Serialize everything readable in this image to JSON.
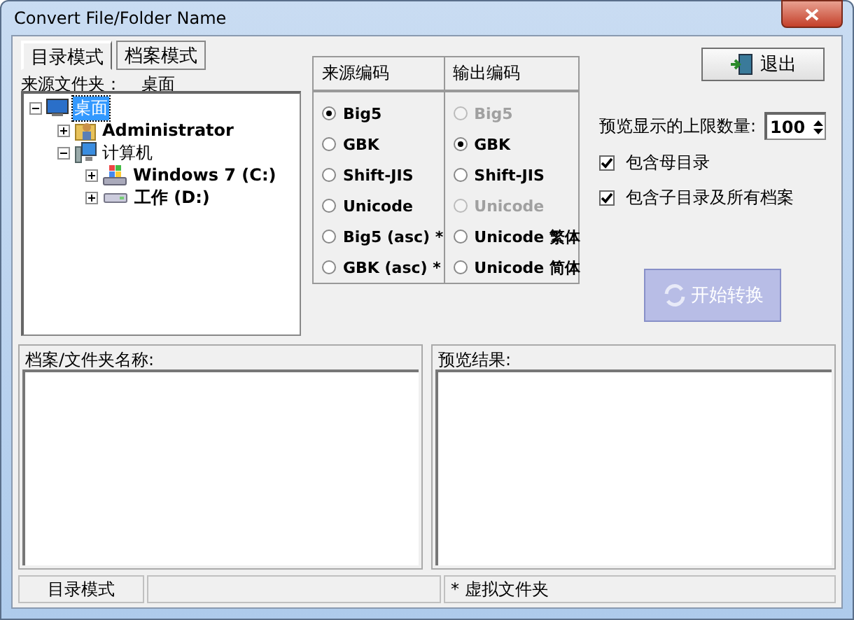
{
  "window": {
    "title": "Convert File/Folder Name"
  },
  "tabs": [
    {
      "label": "目录模式",
      "selected": true
    },
    {
      "label": "档案模式",
      "selected": false
    }
  ],
  "exit_button": {
    "label": "退出"
  },
  "source_folder": {
    "label": "来源文件夹：",
    "value": "桌面"
  },
  "tree": [
    {
      "label": "桌面",
      "kind": "desktop",
      "bold": false,
      "expanded": true,
      "selected": true,
      "children": [
        {
          "label": "Administrator",
          "kind": "user",
          "bold": true,
          "expanded": false,
          "selected": false
        },
        {
          "label": "计算机",
          "kind": "computer",
          "bold": false,
          "expanded": true,
          "selected": false,
          "children": [
            {
              "label": "Windows 7 (C:)",
              "kind": "system-drive",
              "bold": true,
              "expanded": false,
              "selected": false
            },
            {
              "label": "工作 (D:)",
              "kind": "drive",
              "bold": true,
              "expanded": false,
              "selected": false
            }
          ]
        }
      ]
    }
  ],
  "encoding": {
    "columns": [
      "来源编码",
      "输出编码"
    ],
    "source": [
      {
        "label": "Big5",
        "selected": true,
        "disabled": false
      },
      {
        "label": "GBK",
        "selected": false,
        "disabled": false
      },
      {
        "label": "Shift-JIS",
        "selected": false,
        "disabled": false
      },
      {
        "label": "Unicode",
        "selected": false,
        "disabled": false
      },
      {
        "label": "Big5 (asc) *",
        "selected": false,
        "disabled": false
      },
      {
        "label": "GBK (asc) *",
        "selected": false,
        "disabled": false
      }
    ],
    "output": [
      {
        "label": "Big5",
        "selected": false,
        "disabled": true
      },
      {
        "label": "GBK",
        "selected": true,
        "disabled": false
      },
      {
        "label": "Shift-JIS",
        "selected": false,
        "disabled": false
      },
      {
        "label": "Unicode",
        "selected": false,
        "disabled": true
      },
      {
        "label": "Unicode 繁体",
        "selected": false,
        "disabled": false
      },
      {
        "label": "Unicode 简体",
        "selected": false,
        "disabled": false
      }
    ]
  },
  "preview_limit": {
    "label": "预览显示的上限数量:",
    "value": "100"
  },
  "checkboxes": [
    {
      "label": "包含母目录",
      "checked": true
    },
    {
      "label": "包含子目录及所有档案",
      "checked": true
    }
  ],
  "start_button": {
    "label": "开始转换",
    "disabled": true
  },
  "panels": [
    {
      "title": "档案/文件夹名称:"
    },
    {
      "title": "预览结果:"
    }
  ],
  "status_bar": {
    "mode": "目录模式",
    "note": "* 虚拟文件夹"
  }
}
